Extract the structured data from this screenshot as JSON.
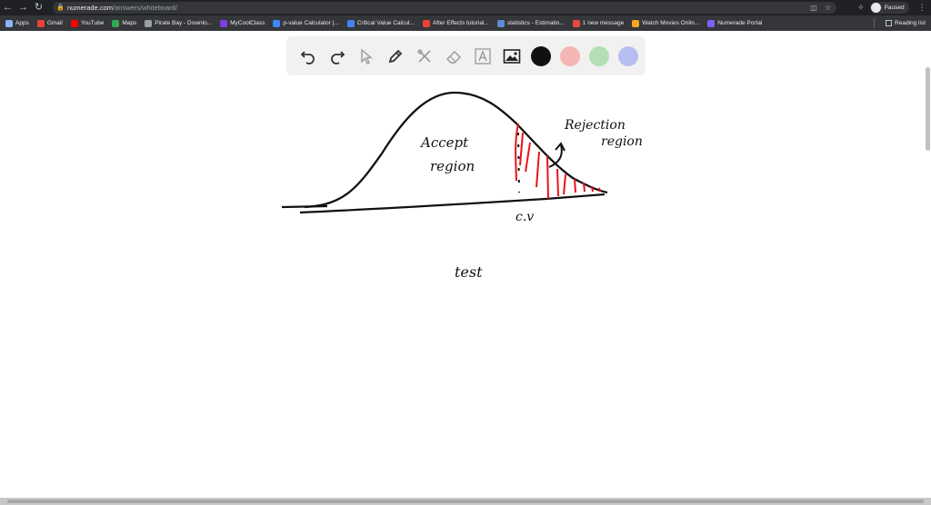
{
  "browser": {
    "url_host": "numerade.com",
    "url_path": "/answers/whiteboard/",
    "profile_status": "Paused"
  },
  "bookmarks": [
    {
      "label": "Apps",
      "color": "#8ab4f8"
    },
    {
      "label": "Gmail",
      "color": "#ea4335"
    },
    {
      "label": "YouTube",
      "color": "#ff0000"
    },
    {
      "label": "Maps",
      "color": "#34a853"
    },
    {
      "label": "Pirate Bay - Downlo...",
      "color": "#9aa0a6"
    },
    {
      "label": "MyCoolClass",
      "color": "#7b3fe4"
    },
    {
      "label": "p-value Calculator |...",
      "color": "#4285f4"
    },
    {
      "label": "Critical Value Calcul...",
      "color": "#4285f4"
    },
    {
      "label": "After Effects tutorial...",
      "color": "#ea4335"
    },
    {
      "label": "statistics - Estimatio...",
      "color": "#5f8bd6"
    },
    {
      "label": "1 new message",
      "color": "#e94a3f"
    },
    {
      "label": "Watch Movies Onlin...",
      "color": "#f5a623"
    },
    {
      "label": "Numerade Portal",
      "color": "#7b61ff"
    }
  ],
  "reading_list": "Reading list",
  "toolbar": {
    "tools": [
      "undo-icon",
      "redo-icon",
      "pointer-icon",
      "pen-icon",
      "tools-icon",
      "eraser-icon",
      "text-icon",
      "image-icon"
    ],
    "colors": [
      "#111111",
      "#f4b6b4",
      "#b4deb4",
      "#b8bdf2"
    ]
  },
  "board": {
    "accept_region_line1": "Accept",
    "accept_region_line2": "region",
    "rejection_region_line1": "Rejection",
    "rejection_region_line2": "region",
    "critical_value": "c.v",
    "test": "test"
  }
}
